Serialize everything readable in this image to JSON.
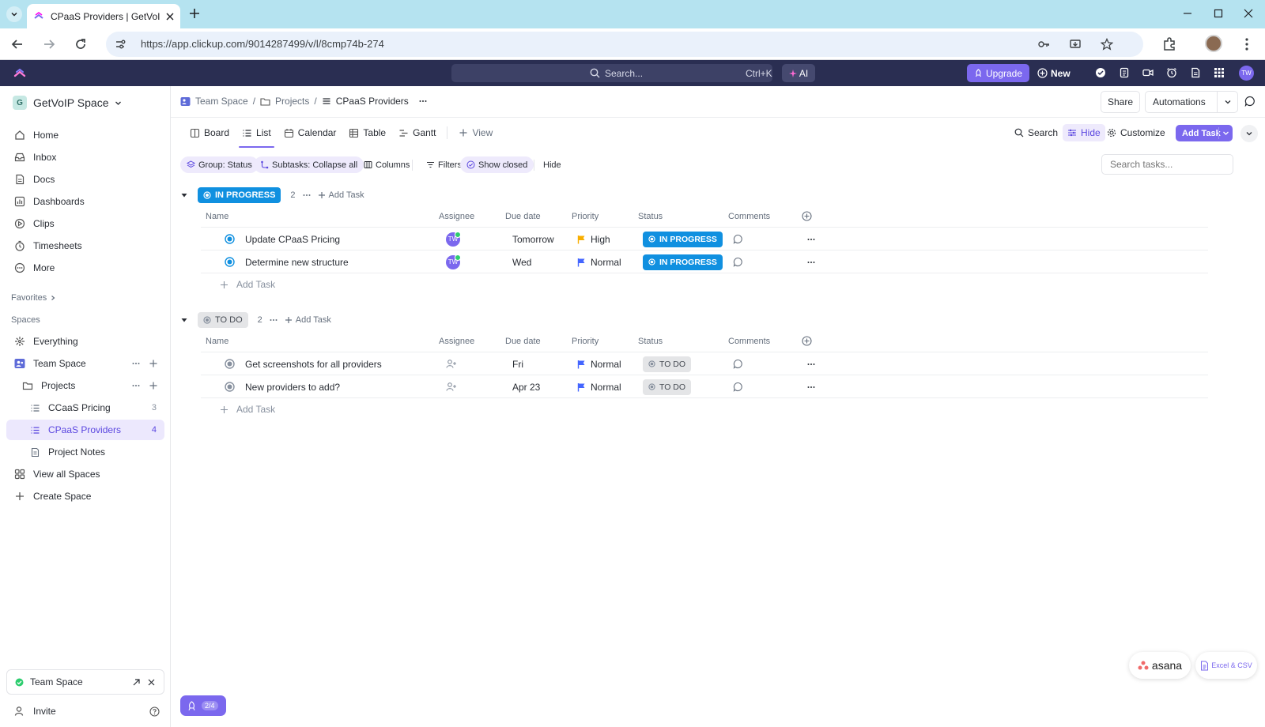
{
  "browser": {
    "tab_title": "CPaaS Providers | GetVoIP Sp",
    "url": "https://app.clickup.com/9014287499/v/l/8cmp74b-274"
  },
  "topbar": {
    "search_placeholder": "Search...",
    "search_shortcut": "Ctrl+K",
    "ai_label": "AI",
    "upgrade_label": "Upgrade",
    "new_label": "New",
    "avatar_initials": "TW"
  },
  "sidebar": {
    "workspace_initial": "G",
    "workspace_name": "GetVoIP Space",
    "nav": [
      {
        "label": "Home"
      },
      {
        "label": "Inbox"
      },
      {
        "label": "Docs"
      },
      {
        "label": "Dashboards"
      },
      {
        "label": "Clips"
      },
      {
        "label": "Timesheets"
      },
      {
        "label": "More"
      }
    ],
    "favorites_label": "Favorites",
    "spaces_label": "Spaces",
    "everything_label": "Everything",
    "team_space_label": "Team Space",
    "projects_label": "Projects",
    "lists": [
      {
        "label": "CCaaS Pricing",
        "count": "3"
      },
      {
        "label": "CPaaS Providers",
        "count": "4"
      }
    ],
    "project_notes_label": "Project Notes",
    "view_all_spaces": "View all Spaces",
    "create_space": "Create Space",
    "footer_space": "Team Space",
    "invite_label": "Invite"
  },
  "main": {
    "breadcrumb": [
      "Team Space",
      "Projects",
      "CPaaS Providers"
    ],
    "share_label": "Share",
    "automations_label": "Automations",
    "views": [
      "Board",
      "List",
      "Calendar",
      "Table",
      "Gantt",
      "View"
    ],
    "right_tools": {
      "search": "Search",
      "hide": "Hide",
      "customize": "Customize",
      "add_task": "Add Task"
    },
    "chips": {
      "group": "Group: Status",
      "subtasks": "Subtasks: Collapse all",
      "columns": "Columns",
      "filters": "Filters",
      "show_closed": "Show closed",
      "hide": "Hide"
    },
    "search_tasks_placeholder": "Search tasks...",
    "columns": [
      "Name",
      "Assignee",
      "Due date",
      "Priority",
      "Status",
      "Comments"
    ],
    "add_task_label": "Add Task",
    "groups": [
      {
        "status": "IN PROGRESS",
        "count": "2",
        "tasks": [
          {
            "name": "Update CPaaS Pricing",
            "assignee": "TW",
            "due": "Tomorrow",
            "priority": "High",
            "priority_color": "#f8ae00",
            "status": "IN PROGRESS"
          },
          {
            "name": "Determine new structure",
            "assignee": "TW",
            "due": "Wed",
            "priority": "Normal",
            "priority_color": "#4466ff",
            "status": "IN PROGRESS"
          }
        ]
      },
      {
        "status": "TO DO",
        "count": "2",
        "tasks": [
          {
            "name": "Get screenshots for all providers",
            "assignee": "",
            "due": "Fri",
            "priority": "Normal",
            "priority_color": "#4466ff",
            "status": "TO DO"
          },
          {
            "name": "New providers to add?",
            "assignee": "",
            "due": "Apr 23",
            "priority": "Normal",
            "priority_color": "#4466ff",
            "status": "TO DO"
          }
        ]
      }
    ]
  },
  "bottom": {
    "progress_label": "2/4",
    "asana_label": "asana",
    "excel_label": "Excel & CSV"
  },
  "colors": {
    "accent": "#7b68ee",
    "in_progress": "#1090e0",
    "topbar": "#2a2e52"
  }
}
